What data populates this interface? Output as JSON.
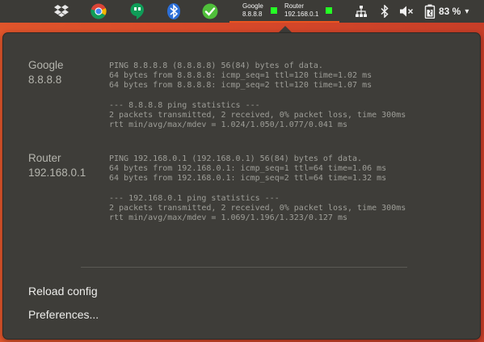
{
  "panel": {
    "tray_icons": [
      {
        "name": "dropbox-icon"
      },
      {
        "name": "chrome-icon"
      },
      {
        "name": "hangouts-icon"
      },
      {
        "name": "bluetooth-app-icon"
      },
      {
        "name": "checkmark-icon"
      }
    ],
    "ping_indicator": {
      "hosts": [
        {
          "name": "Google",
          "address": "8.8.8.8",
          "status_color": "#25ff25"
        },
        {
          "name": "Router",
          "address": "192.168.0.1",
          "status_color": "#25ff25"
        }
      ]
    },
    "system_icons": [
      "network-icon",
      "bluetooth-icon",
      "volume-muted-icon",
      "battery-icon"
    ],
    "battery_percent": "83 %"
  },
  "popup": {
    "hosts": [
      {
        "label_name": "Google",
        "label_address": "8.8.8.8",
        "output": "PING 8.8.8.8 (8.8.8.8) 56(84) bytes of data.\n64 bytes from 8.8.8.8: icmp_seq=1 ttl=120 time=1.02 ms\n64 bytes from 8.8.8.8: icmp_seq=2 ttl=120 time=1.07 ms\n\n--- 8.8.8.8 ping statistics ---\n2 packets transmitted, 2 received, 0% packet loss, time 300ms\nrtt min/avg/max/mdev = 1.024/1.050/1.077/0.041 ms"
      },
      {
        "label_name": "Router",
        "label_address": "192.168.0.1",
        "output": "PING 192.168.0.1 (192.168.0.1) 56(84) bytes of data.\n64 bytes from 192.168.0.1: icmp_seq=1 ttl=64 time=1.06 ms\n64 bytes from 192.168.0.1: icmp_seq=2 ttl=64 time=1.32 ms\n\n--- 192.168.0.1 ping statistics ---\n2 packets transmitted, 2 received, 0% packet loss, time 300ms\nrtt min/avg/max/mdev = 1.069/1.196/1.323/0.127 ms"
      }
    ],
    "menu": {
      "reload_label": "Reload config",
      "preferences_label": "Preferences..."
    }
  },
  "colors": {
    "accent": "#e95420",
    "panel_bg": "#3c3b37",
    "menu_bg": "#3e3d39",
    "status_ok": "#25ff25"
  }
}
